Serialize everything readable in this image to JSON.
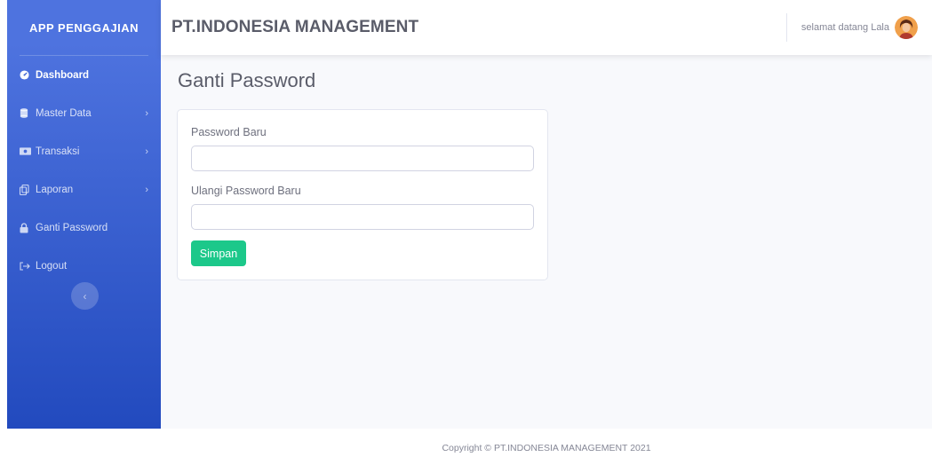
{
  "sidebar": {
    "brand": "APP PENGGAJIAN",
    "items": [
      {
        "label": "Dashboard",
        "icon": "tachometer-icon",
        "has_chevron": false,
        "active": true
      },
      {
        "label": "Master Data",
        "icon": "database-icon",
        "has_chevron": true
      },
      {
        "label": "Transaksi",
        "icon": "money-icon",
        "has_chevron": true
      },
      {
        "label": "Laporan",
        "icon": "copy-icon",
        "has_chevron": true
      },
      {
        "label": "Ganti Password",
        "icon": "lock-icon",
        "has_chevron": false
      },
      {
        "label": "Logout",
        "icon": "sign-out-icon",
        "has_chevron": false
      }
    ],
    "chevron": "›",
    "toggle_glyph": "‹"
  },
  "topbar": {
    "company": "PT.INDONESIA MANAGEMENT",
    "welcome": "selamat datang Lala"
  },
  "page": {
    "title": "Ganti Password"
  },
  "form": {
    "new_password_label": "Password Baru",
    "new_password_value": "",
    "repeat_password_label": "Ulangi Password Baru",
    "repeat_password_value": "",
    "save_label": "Simpan"
  },
  "footer": {
    "text": "Copyright © PT.INDONESIA MANAGEMENT 2021"
  },
  "colors": {
    "sidebar_top": "#4e73df",
    "sidebar_bottom": "#224abe",
    "save_button": "#1cc88a",
    "background": "#f8f9fc"
  }
}
